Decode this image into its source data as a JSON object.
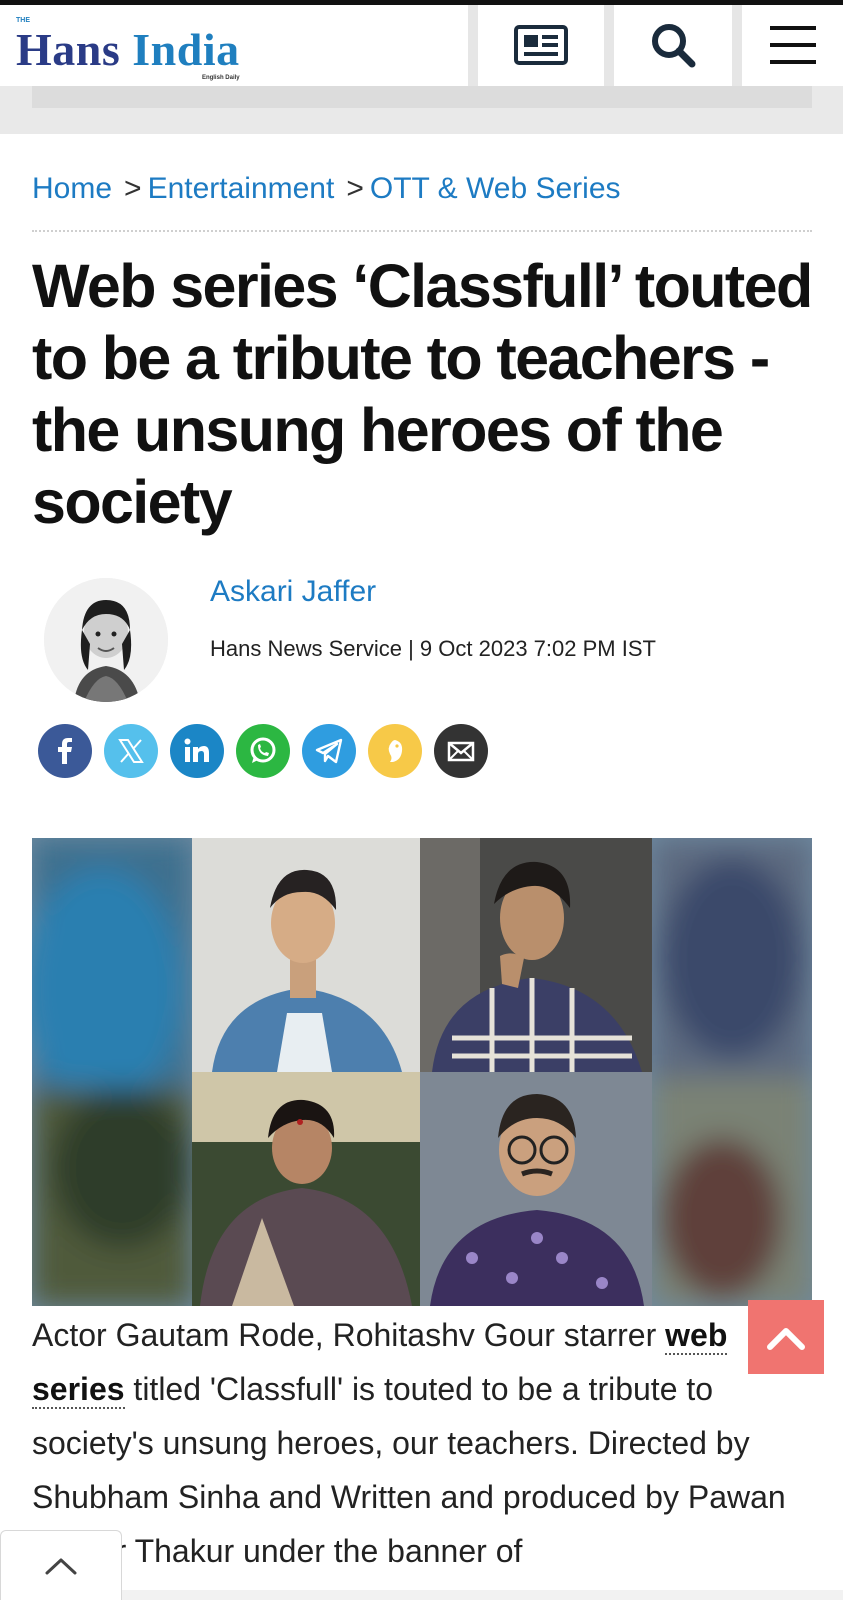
{
  "header": {
    "logo_small": "THE",
    "logo_hans": "Hans",
    "logo_india": "India",
    "logo_sub": "English Daily",
    "icons": {
      "epaper": "newspaper-icon",
      "search": "search-icon",
      "menu": "hamburger-menu-icon"
    }
  },
  "breadcrumb": {
    "home": "Home",
    "sep1": ">",
    "entertainment": "Entertainment",
    "sep2": ">",
    "section": "OTT & Web Series"
  },
  "article": {
    "title": "Web series ‘Classfull’ touted to be a tribute to teachers - the unsung heroes of the society",
    "author": "Askari Jaffer",
    "source": "Hans News Service",
    "meta_sep": "|",
    "date": "9 Oct 2023 7:02 PM IST",
    "body_pre_link": "Actor Gautam Rode, Rohitashv Gour starrer ",
    "body_link": "web series",
    "body_post_link": " titled 'Classfull' is touted to be a tribute to society's unsung heroes, our teachers. Directed by Shubham Sinha and Written and produced by Pawan Kumar Thakur under the banner of"
  },
  "share": [
    {
      "name": "facebook",
      "icon": "facebook-icon",
      "color": "#3b5998"
    },
    {
      "name": "x",
      "icon": "x-icon",
      "color": "#55c0ec"
    },
    {
      "name": "linkedin",
      "icon": "linkedin-icon",
      "color": "#1b86c6"
    },
    {
      "name": "whatsapp",
      "icon": "whatsapp-icon",
      "color": "#2cb742"
    },
    {
      "name": "telegram",
      "icon": "telegram-icon",
      "color": "#2f9de0"
    },
    {
      "name": "koo",
      "icon": "koo-icon",
      "color": "#f7c948"
    },
    {
      "name": "email",
      "icon": "email-icon",
      "color": "#333333"
    }
  ],
  "colors": {
    "link": "#1d7bc3",
    "brand": "#2a3b86",
    "to_top": "#f07470"
  }
}
